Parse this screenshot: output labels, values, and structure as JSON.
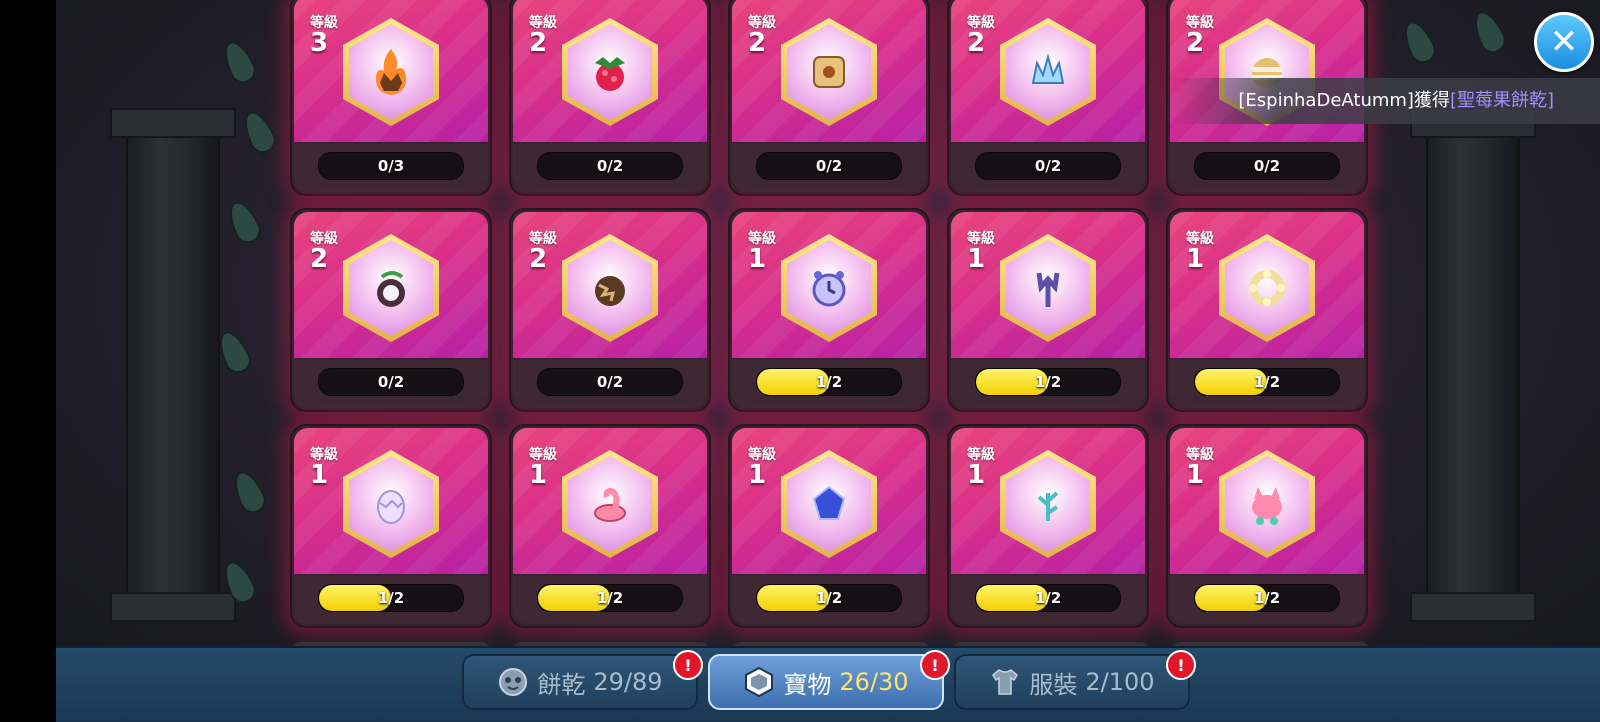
{
  "notice": {
    "player": "[EspinhaDeAtumm]",
    "action": "獲得",
    "item": "[聖莓果餅乾]"
  },
  "close_label": "✕",
  "level_label": "等級",
  "treasures": [
    {
      "icon": "flame-crown-icon",
      "level": "3",
      "progress": "0/3",
      "fill": 0
    },
    {
      "icon": "raspberry-icon",
      "level": "2",
      "progress": "0/2",
      "fill": 0
    },
    {
      "icon": "treasure-scroll-icon",
      "level": "2",
      "progress": "0/2",
      "fill": 0
    },
    {
      "icon": "ice-crystal-crown-icon",
      "level": "2",
      "progress": "0/2",
      "fill": 0
    },
    {
      "icon": "cookie-mummy-icon",
      "level": "2",
      "progress": "0/2",
      "fill": 0
    },
    {
      "icon": "dark-bomb-icon",
      "level": "2",
      "progress": "0/2",
      "fill": 0
    },
    {
      "icon": "cracked-nut-icon",
      "level": "2",
      "progress": "0/2",
      "fill": 0
    },
    {
      "icon": "alarm-clock-icon",
      "level": "1",
      "progress": "1/2",
      "fill": 0.5
    },
    {
      "icon": "trident-icon",
      "level": "1",
      "progress": "1/2",
      "fill": 0.5
    },
    {
      "icon": "flower-wreath-icon",
      "level": "1",
      "progress": "1/2",
      "fill": 0.5
    },
    {
      "icon": "dragon-egg-icon",
      "level": "1",
      "progress": "1/2",
      "fill": 0.5
    },
    {
      "icon": "flamingo-float-icon",
      "level": "1",
      "progress": "1/2",
      "fill": 0.5
    },
    {
      "icon": "blue-gem-icon",
      "level": "1",
      "progress": "1/2",
      "fill": 0.5
    },
    {
      "icon": "frost-branch-icon",
      "level": "1",
      "progress": "1/2",
      "fill": 0.5
    },
    {
      "icon": "jelly-cat-icon",
      "level": "1",
      "progress": "1/2",
      "fill": 0.5
    }
  ],
  "tabs": [
    {
      "icon": "cookie-face-icon",
      "label": "餅乾",
      "count": "29/89",
      "active": false
    },
    {
      "icon": "treasure-hex-icon",
      "label": "寶物",
      "count": "26/30",
      "active": true
    },
    {
      "icon": "costume-shirt-icon",
      "label": "服裝",
      "count": "2/100",
      "active": false
    }
  ],
  "alert_mark": "!",
  "colors": {
    "card_pink": "#d92f8a",
    "progress_yellow": "#f2d000",
    "tab_active": "#3d6fae",
    "notice_item": "#a58cff"
  }
}
